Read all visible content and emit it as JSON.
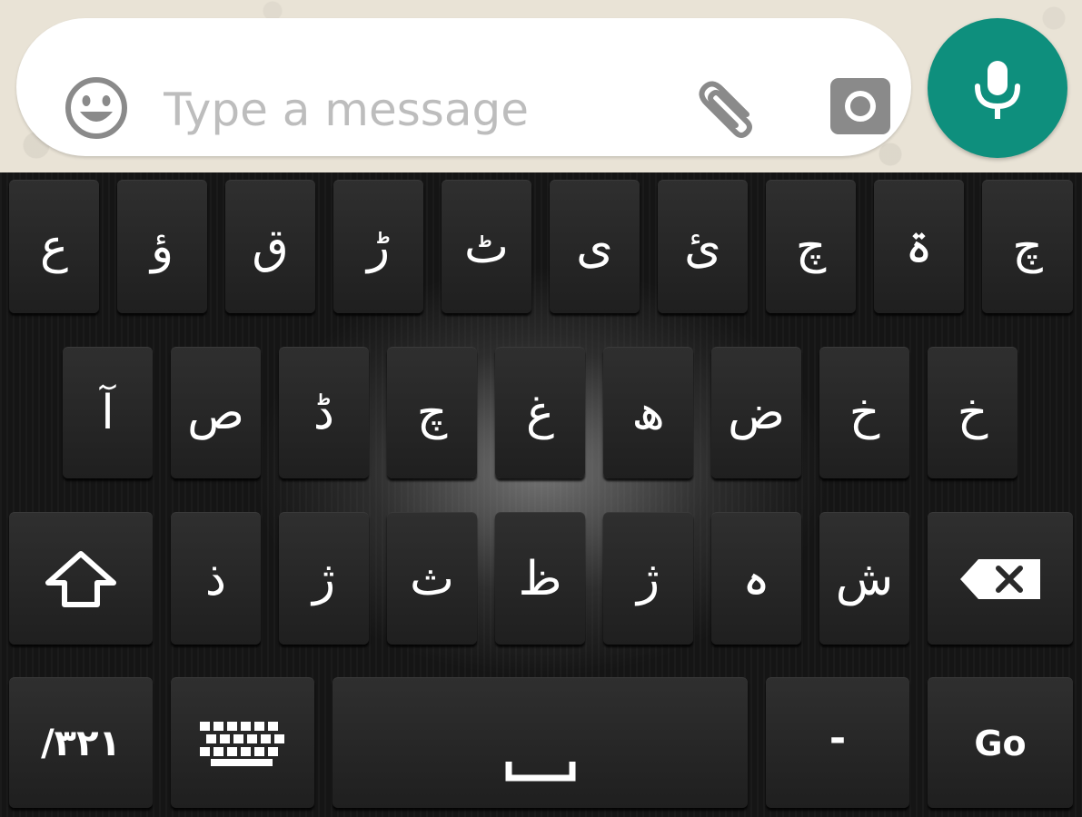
{
  "compose_bar": {
    "placeholder": "Type a message",
    "emoji_icon": "emoji-icon",
    "attach_icon": "paperclip-icon",
    "camera_icon": "camera-icon",
    "mic_icon": "microphone-icon",
    "mic_color": "#0e8f7d"
  },
  "keyboard": {
    "row1": [
      "ع",
      "ؤ",
      "ق",
      "ڑ",
      "ٹ",
      "ى",
      "ئ",
      "چ",
      "ۃ",
      "چ"
    ],
    "row2": [
      "آ",
      "ص",
      "ڈ",
      "چ",
      "غ",
      "ھ",
      "ض",
      "خ",
      "خ"
    ],
    "row3": [
      "ذ",
      "ژ",
      "ث",
      "ظ",
      "ژ",
      "ہ",
      "ش"
    ],
    "shift_icon": "shift-arrow-icon",
    "backspace_icon": "backspace-icon",
    "numbers_label": "/۳۲۱",
    "keyboard_icon": "keyboard-icon",
    "space_icon": "space-bar-icon",
    "dash_label": "-",
    "go_label": "Go"
  }
}
